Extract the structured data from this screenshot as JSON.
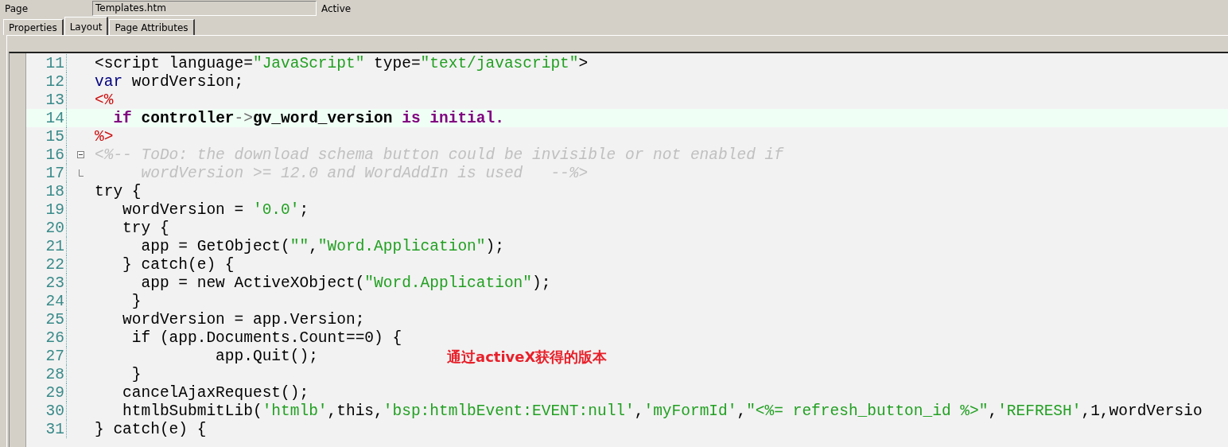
{
  "header": {
    "label": "Page",
    "field_value": "Templates.htm",
    "status": "Active"
  },
  "tabs": [
    {
      "label": "Properties",
      "selected": false
    },
    {
      "label": "Layout",
      "selected": true
    },
    {
      "label": "Page Attributes",
      "selected": false
    }
  ],
  "editor": {
    "lines": [
      {
        "number": "11",
        "highlighted": false,
        "tokens": [
          {
            "t": "<script language=",
            "kind": "plain"
          },
          {
            "t": "\"JavaScript\"",
            "kind": "string"
          },
          {
            "t": " type=",
            "kind": "plain"
          },
          {
            "t": "\"text/javascript\"",
            "kind": "string"
          },
          {
            "t": ">",
            "kind": "plain"
          }
        ]
      },
      {
        "number": "12",
        "highlighted": false,
        "tokens": [
          {
            "t": "var",
            "kind": "keyword"
          },
          {
            "t": " wordVersion;",
            "kind": "plain"
          }
        ]
      },
      {
        "number": "13",
        "highlighted": false,
        "tokens": [
          {
            "t": "<%",
            "kind": "tag"
          }
        ]
      },
      {
        "number": "14",
        "highlighted": true,
        "tokens": [
          {
            "t": "  if",
            "kind": "abap"
          },
          {
            "t": " controller",
            "kind": "bold"
          },
          {
            "t": "->",
            "kind": "arrow"
          },
          {
            "t": "gv_word_version",
            "kind": "bold"
          },
          {
            "t": " is initial.",
            "kind": "abap"
          }
        ]
      },
      {
        "number": "15",
        "highlighted": false,
        "tokens": [
          {
            "t": "%>",
            "kind": "tag"
          }
        ]
      },
      {
        "number": "16",
        "highlighted": false,
        "kind": "fold-start",
        "tokens": [
          {
            "t": "<%-- ToDo: the download schema button could be invisible or not enabled if",
            "kind": "comment"
          }
        ]
      },
      {
        "number": "17",
        "highlighted": false,
        "kind": "fold-end",
        "tokens": [
          {
            "t": "     wordVersion >= 12.0 and WordAddIn is used   --%>",
            "kind": "comment"
          }
        ]
      },
      {
        "number": "18",
        "highlighted": false,
        "tokens": [
          {
            "t": "try {",
            "kind": "plain"
          }
        ]
      },
      {
        "number": "19",
        "highlighted": false,
        "tokens": [
          {
            "t": "   wordVersion = ",
            "kind": "plain"
          },
          {
            "t": "'0.0'",
            "kind": "string"
          },
          {
            "t": ";",
            "kind": "plain"
          }
        ]
      },
      {
        "number": "20",
        "highlighted": false,
        "tokens": [
          {
            "t": "   try {",
            "kind": "plain"
          }
        ]
      },
      {
        "number": "21",
        "highlighted": false,
        "tokens": [
          {
            "t": "     app = GetObject(",
            "kind": "plain"
          },
          {
            "t": "\"\"",
            "kind": "string"
          },
          {
            "t": ",",
            "kind": "plain"
          },
          {
            "t": "\"Word.Application\"",
            "kind": "string"
          },
          {
            "t": ");",
            "kind": "plain"
          }
        ]
      },
      {
        "number": "22",
        "highlighted": false,
        "tokens": [
          {
            "t": "   } catch(e) {",
            "kind": "plain"
          }
        ]
      },
      {
        "number": "23",
        "highlighted": false,
        "tokens": [
          {
            "t": "     app = new ActiveXObject(",
            "kind": "plain"
          },
          {
            "t": "\"Word.Application\"",
            "kind": "string"
          },
          {
            "t": ");",
            "kind": "plain"
          }
        ]
      },
      {
        "number": "24",
        "highlighted": false,
        "tokens": [
          {
            "t": "    }",
            "kind": "plain"
          }
        ]
      },
      {
        "number": "25",
        "highlighted": false,
        "tokens": [
          {
            "t": "   wordVersion = app.Version;",
            "kind": "plain"
          }
        ]
      },
      {
        "number": "26",
        "highlighted": false,
        "tokens": [
          {
            "t": "    if (app.Documents.Count==0) {",
            "kind": "plain"
          }
        ]
      },
      {
        "number": "27",
        "highlighted": false,
        "tokens": [
          {
            "t": "             app.Quit();",
            "kind": "plain"
          }
        ]
      },
      {
        "number": "28",
        "highlighted": false,
        "tokens": [
          {
            "t": "    }",
            "kind": "plain"
          }
        ]
      },
      {
        "number": "29",
        "highlighted": false,
        "tokens": [
          {
            "t": "   cancelAjaxRequest();",
            "kind": "plain"
          }
        ]
      },
      {
        "number": "30",
        "highlighted": false,
        "tokens": [
          {
            "t": "   htmlbSubmitLib(",
            "kind": "plain"
          },
          {
            "t": "'htmlb'",
            "kind": "string"
          },
          {
            "t": ",this,",
            "kind": "plain"
          },
          {
            "t": "'bsp:htmlbEvent:EVENT:null'",
            "kind": "string"
          },
          {
            "t": ",",
            "kind": "plain"
          },
          {
            "t": "'myFormId'",
            "kind": "string"
          },
          {
            "t": ",",
            "kind": "plain"
          },
          {
            "t": "\"<%= refresh_button_id %>\"",
            "kind": "string"
          },
          {
            "t": ",",
            "kind": "plain"
          },
          {
            "t": "'REFRESH'",
            "kind": "string"
          },
          {
            "t": ",1,wordVersio",
            "kind": "plain"
          }
        ]
      },
      {
        "number": "31",
        "highlighted": false,
        "tokens": [
          {
            "t": "} catch(e) {",
            "kind": "plain"
          }
        ]
      }
    ]
  },
  "annotation": "通过activeX获得的版本"
}
